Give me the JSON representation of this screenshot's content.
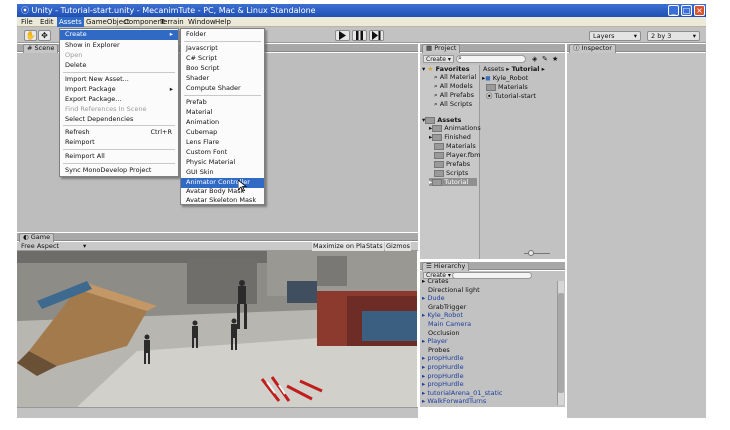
{
  "window": {
    "title": "Unity - Tutorial-start.unity - MecanimTute - PC, Mac & Linux Standalone",
    "controls": [
      "_",
      "□",
      "×"
    ]
  },
  "menubar": [
    "File",
    "Edit",
    "Assets",
    "GameObject",
    "Component",
    "Terrain",
    "Window",
    "Help"
  ],
  "toolbar": {
    "layers": "Layers",
    "layout": "2 by 3",
    "play_icon": "play-icon",
    "pause_icon": "pause-icon",
    "step_icon": "step-icon"
  },
  "scene": {
    "tab": "Scene"
  },
  "game": {
    "tab": "Game",
    "aspect": "Free Aspect",
    "maximize": "Maximize on Play",
    "stats": "Stats",
    "gizmos": "Gizmos"
  },
  "assets_menu": {
    "items": [
      {
        "label": "Create",
        "submenu": true
      },
      {
        "label": "Show in Explorer"
      },
      {
        "label": "Open",
        "disabled": true
      },
      {
        "label": "Delete"
      },
      {
        "label": "Import New Asset..."
      },
      {
        "label": "Import Package",
        "submenu": true
      },
      {
        "label": "Export Package..."
      },
      {
        "label": "Find References In Scene",
        "disabled": true
      },
      {
        "label": "Select Dependencies"
      },
      {
        "label": "Refresh",
        "shortcut": "Ctrl+R"
      },
      {
        "label": "Reimport"
      },
      {
        "label": "Reimport All"
      },
      {
        "label": "Sync MonoDevelop Project"
      }
    ]
  },
  "create_menu": {
    "items": [
      "Folder",
      "Javascript",
      "C# Script",
      "Boo Script",
      "Shader",
      "Compute Shader",
      "Prefab",
      "Material",
      "Animation",
      "Cubemap",
      "Lens Flare",
      "Custom Font",
      "Physic Material",
      "GUI Skin",
      "Animator Controller",
      "Avatar Body Mask",
      "Avatar Skeleton Mask"
    ],
    "selected": "Animator Controller"
  },
  "project": {
    "tab": "Project",
    "create": "Create",
    "favorites_header": "Favorites",
    "favorites": [
      "All Material",
      "All Models",
      "All Prefabs",
      "All Scripts"
    ],
    "assets_header": "Assets",
    "assets": [
      "Animations",
      "Finished",
      "Materials",
      "Player.fbm",
      "Prefabs",
      "Scripts",
      "Tutorial"
    ],
    "breadcrumb_root": "Assets",
    "breadcrumb_current": "Tutorial",
    "files": [
      "Kyle_Robot",
      "Materials",
      "Tutorial-start"
    ]
  },
  "inspector": {
    "tab": "Inspector"
  },
  "hierarchy": {
    "tab": "Hierarchy",
    "create": "Create",
    "items": [
      {
        "label": "Crates",
        "arrow": true,
        "blue": false
      },
      {
        "label": "Directional light",
        "arrow": false,
        "blue": false
      },
      {
        "label": "Dude",
        "arrow": true,
        "blue": true
      },
      {
        "label": "GrabTrigger",
        "arrow": false,
        "blue": false
      },
      {
        "label": "Kyle_Robot",
        "arrow": true,
        "blue": true
      },
      {
        "label": "Main Camera",
        "arrow": false,
        "blue": true
      },
      {
        "label": "Occlusion",
        "arrow": false,
        "blue": false
      },
      {
        "label": "Player",
        "arrow": true,
        "blue": true
      },
      {
        "label": "Probes",
        "arrow": false,
        "blue": false
      },
      {
        "label": "propHurdle",
        "arrow": true,
        "blue": true
      },
      {
        "label": "propHurdle",
        "arrow": true,
        "blue": true
      },
      {
        "label": "propHurdle",
        "arrow": true,
        "blue": true
      },
      {
        "label": "propHurdle",
        "arrow": true,
        "blue": true
      },
      {
        "label": "tutorialArena_01_static",
        "arrow": true,
        "blue": true
      },
      {
        "label": "WalkForwardTurns",
        "arrow": true,
        "blue": true
      }
    ]
  },
  "colors": {
    "title_blue": "#2a5bc4",
    "selection": "#316ac5",
    "panel": "#c2c2c2",
    "prefab_blue": "#1d3f9c"
  }
}
